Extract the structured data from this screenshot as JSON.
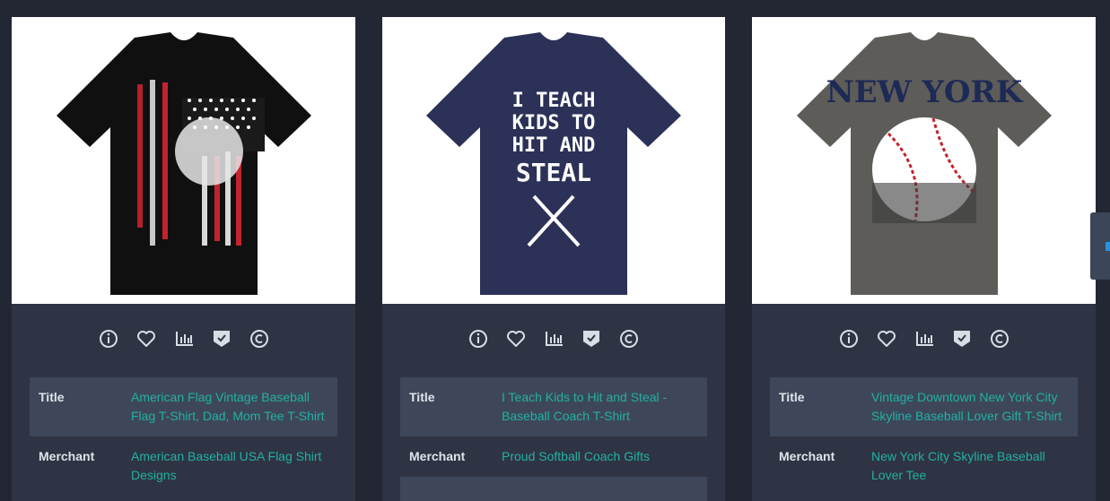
{
  "colors": {
    "background": "#232733",
    "card": "#2e3443",
    "row_alt": "#3d4759",
    "link": "#23b0a2",
    "label": "#dfe3ea",
    "icon": "#d8dde6"
  },
  "icons": [
    "info-icon",
    "heart-icon",
    "bar-chart-icon",
    "shield-check-icon",
    "copyright-icon"
  ],
  "products": [
    {
      "shirt_color": "black",
      "shirt_text": "",
      "title_label": "Title",
      "title": "American Flag Vintage Baseball Flag T-Shirt, Dad, Mom Tee T-Shirt",
      "merchant_label": "Merchant",
      "merchant": "American Baseball USA Flag Shirt Designs"
    },
    {
      "shirt_color": "navy",
      "shirt_text": "I TEACH KIDS TO HIT AND STEAL",
      "title_label": "Title",
      "title": "I Teach Kids to Hit and Steal - Baseball Coach T-Shirt",
      "merchant_label": "Merchant",
      "merchant": "Proud Softball Coach Gifts"
    },
    {
      "shirt_color": "gray",
      "shirt_text": "NEW YORK",
      "title_label": "Title",
      "title": "Vintage Downtown New York City Skyline Baseball Lover Gift T-Shirt",
      "merchant_label": "Merchant",
      "merchant": "New York City Skyline Baseball Lover Tee"
    }
  ]
}
